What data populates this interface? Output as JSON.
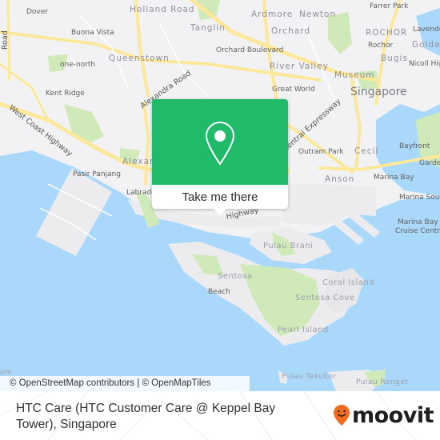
{
  "map": {
    "labels": {
      "dover": "Dover",
      "holland_road": "Holland Road",
      "tanglin": "Tanglin",
      "ardmore": "Ardmore",
      "newton": "Newton",
      "farrer_park": "Farrer Park",
      "rochor_district": "ROCHOR",
      "lavender": "Lavender",
      "rochor": "Rochor",
      "golden": "Golden",
      "buona_vista": "Buona Vista",
      "orchard": "Orchard",
      "orchard_boulevard": "Orchard Boulevard",
      "bugis": "Bugis",
      "nicoll_highway": "Nicoll Hig",
      "queenstown": "Queenstown",
      "one_north": "one-north",
      "river_valley": "River Valley",
      "museum": "Museum",
      "kent_ridge": "Kent Ridge",
      "great_world": "Great World",
      "singapore": "Singapore",
      "alexandra_road": "Alexandra Road",
      "west_coast_highway": "West Coast Highway",
      "central_expressway": "Central Expressway",
      "outram_park": "Outram Park",
      "cecil": "Cecil",
      "bayfront": "Bayfront",
      "gardens": "Garde",
      "alexandra": "Alexan",
      "pasir_panjang": "Pasir Panjang",
      "anson": "Anson",
      "marina_bay": "Marina Bay",
      "labrador": "Labrador",
      "marina_south": "Marina South",
      "highway": "Highway",
      "marina_bay_cruise_centre_1": "Marina Bay",
      "marina_bay_cruise_centre_2": "Cruise Centre",
      "pulau_brani": "Pulau Brani",
      "coral_island": "Coral Island",
      "sentosa": "Sentosa",
      "sentosa_cove": "Sentosa Cove",
      "beach": "Beach",
      "pearl_island": "Pearl Island",
      "pulau_tekukor": "Pulau Tekukor",
      "pulau_renget": "Pulau Renget",
      "road_vertical": "Road",
      "om": "om"
    },
    "attribution": "© OpenStreetMap contributors | © OpenMapTiles",
    "colors": {
      "land": "#f2f2f4",
      "water": "#aad8fb",
      "park": "#cfe9b8",
      "road": "#fce89a"
    }
  },
  "popup": {
    "icon": "map-pin-icon",
    "button_label": "Take me there",
    "accent_color": "#1fba6a"
  },
  "footer": {
    "place_title": "HTC Care (HTC Customer Care @ Keppel Bay Tower), Singapore",
    "brand": "moovit",
    "brand_icon": "moovit-smiley-pin-icon",
    "brand_color": "#f26b21"
  }
}
